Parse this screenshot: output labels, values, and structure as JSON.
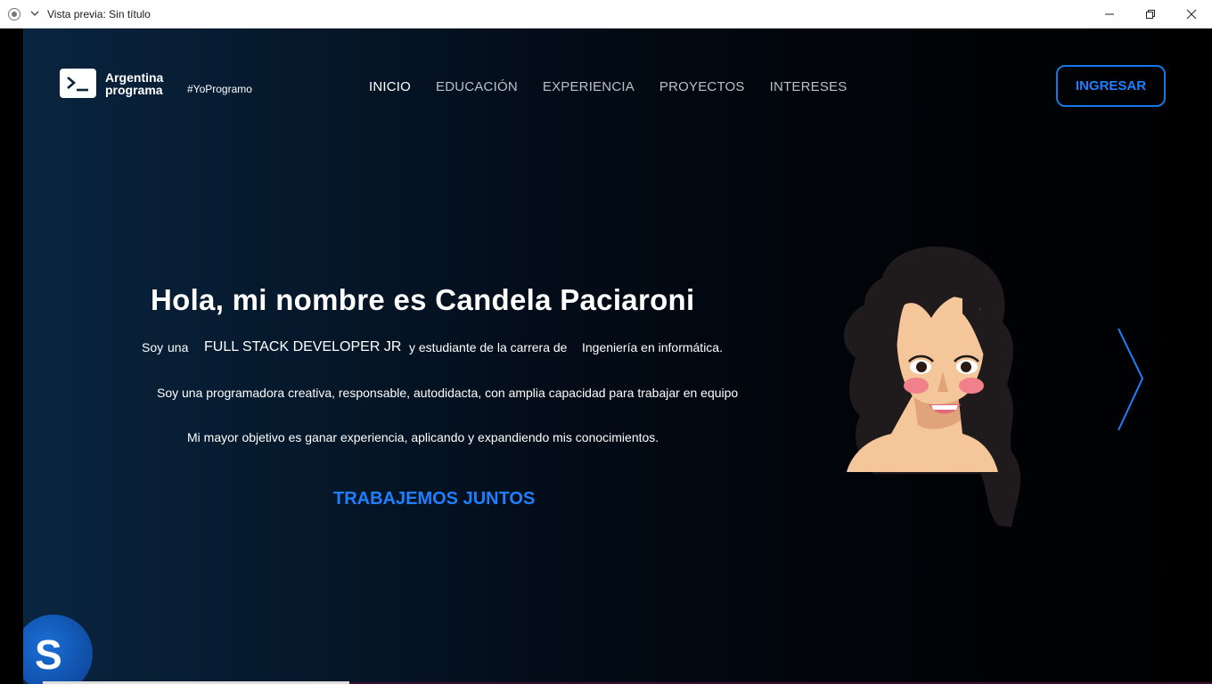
{
  "window": {
    "title": "Vista previa: Sin título",
    "icons": [
      "record-icon",
      "chevron-down-icon",
      "minimize-icon",
      "maximize-icon",
      "close-icon"
    ]
  },
  "header": {
    "logo_line1": "Argentina",
    "logo_line2": "programa",
    "hashtag": "#YoProgramo",
    "nav": [
      {
        "label": "INICIO"
      },
      {
        "label": "EDUCACIÓN"
      },
      {
        "label": "EXPERIENCIA"
      },
      {
        "label": "PROYECTOS"
      },
      {
        "label": "INTERESES"
      }
    ],
    "login_label": "INGRESAR"
  },
  "hero": {
    "title": "Hola, mi nombre es Candela Paciaroni",
    "soy": "Soy",
    "una": "una",
    "role": "FULL STACK DEVELOPER JR",
    "estudiante": "y estudiante de la carrera de",
    "carrera": "Ingeniería en informática.",
    "line2": "Soy una programadora creativa, responsable, autodidacta, con amplia capacidad para trabajar en equipo",
    "line3": "Mi mayor objetivo es ganar experiencia, aplicando y expandiendo mis conocimientos.",
    "cta": "TRABAJEMOS JUNTOS"
  },
  "badge": {
    "letter": "S"
  },
  "colors": {
    "accent": "#1e7fff",
    "background": "#000000",
    "text": "#ffffff",
    "nav_inactive": "#b8c0c8"
  }
}
